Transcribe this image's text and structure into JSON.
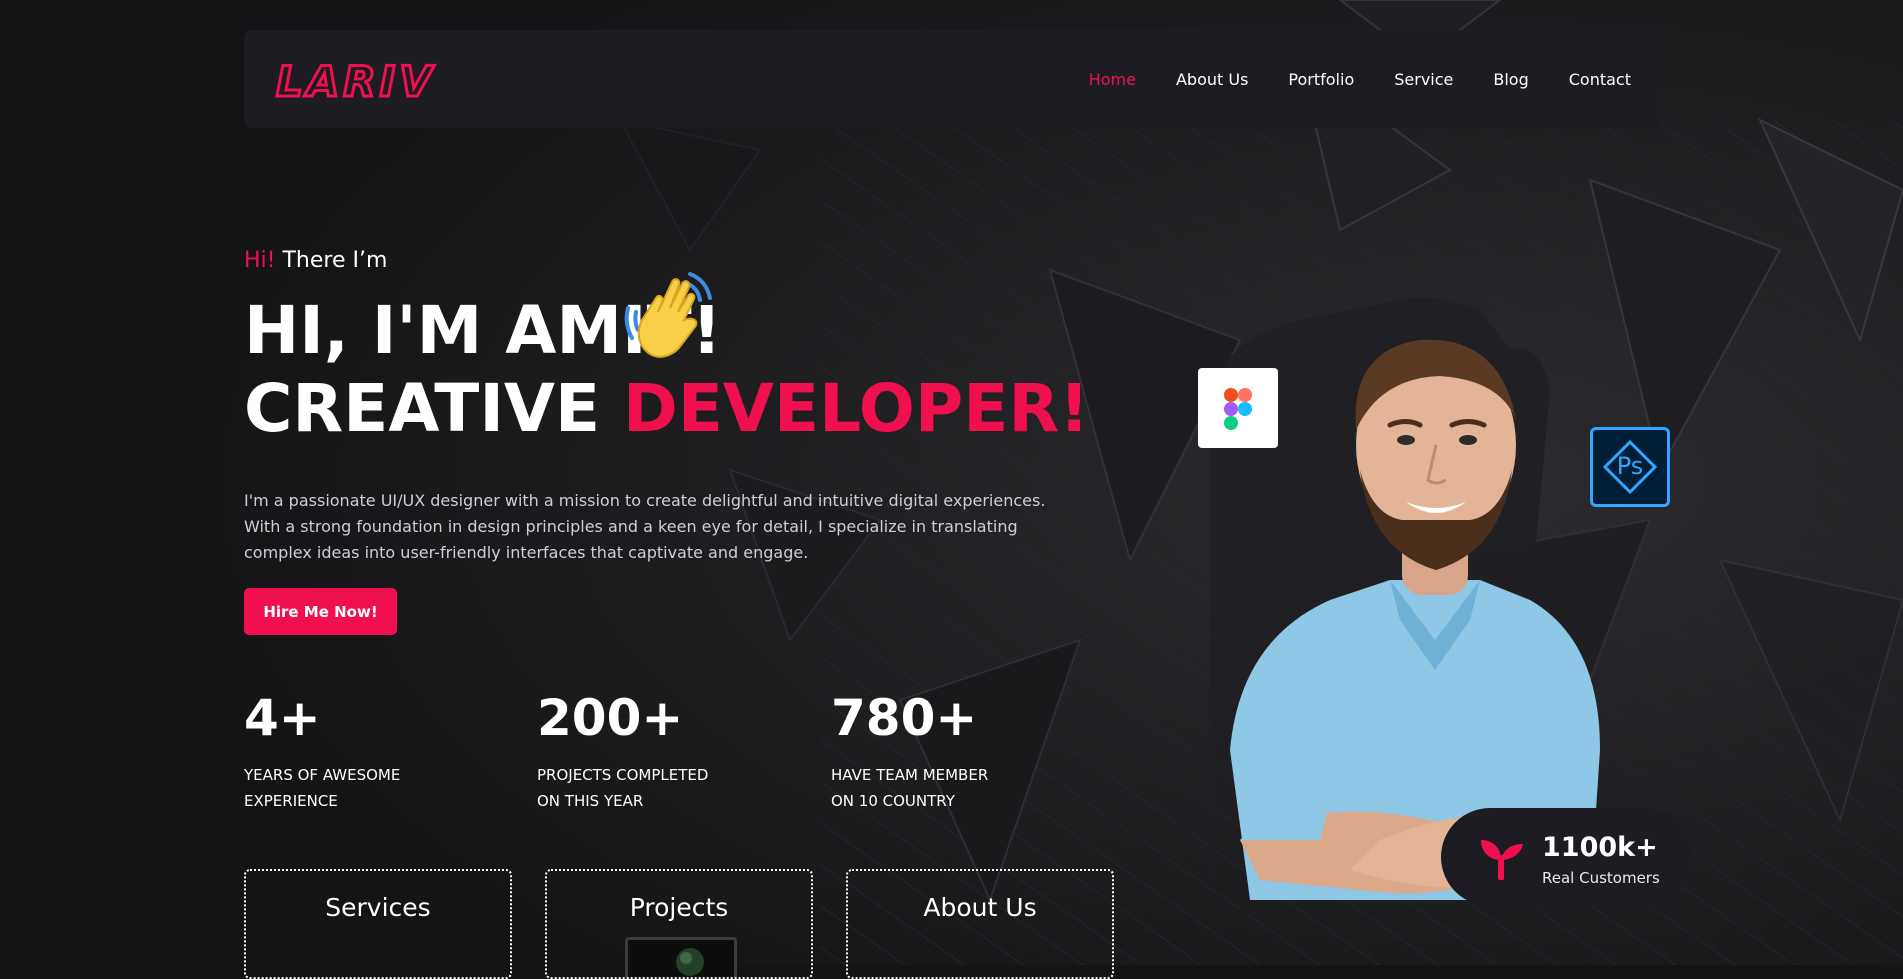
{
  "brand": {
    "logo_text": "LARIV",
    "accent_color": "#f0104f"
  },
  "nav": {
    "items": [
      {
        "label": "Home",
        "active": true
      },
      {
        "label": "About Us",
        "active": false
      },
      {
        "label": "Portfolio",
        "active": false
      },
      {
        "label": "Service",
        "active": false
      },
      {
        "label": "Blog",
        "active": false
      },
      {
        "label": "Contact",
        "active": false
      }
    ]
  },
  "hero": {
    "greeting_hi": "Hi!",
    "greeting_rest": "There I’m",
    "headline_line1": "HI, I'M AMIT!",
    "wave_icon": "waving-hand-icon",
    "headline_line2_white": "CREATIVE",
    "headline_line2_accent": "DEVELOPER!",
    "intro": "I'm a passionate UI/UX designer with a mission to create delightful and intuitive digital experiences. With a strong foundation in design principles and a keen eye for detail, I specialize in translating complex ideas into user-friendly interfaces that captivate and engage.",
    "cta_label": "Hire Me Now!"
  },
  "stats": [
    {
      "value": "4+",
      "label_line1": "YEARS OF AWESOME",
      "label_line2": "EXPERIENCE"
    },
    {
      "value": "200+",
      "label_line1": "PROJECTS COMPLETED",
      "label_line2": "ON THIS YEAR"
    },
    {
      "value": "780+",
      "label_line1": "HAVE TEAM MEMBER",
      "label_line2": "ON 10 COUNTRY"
    }
  ],
  "cards": [
    {
      "title": "Services"
    },
    {
      "title": "Projects"
    },
    {
      "title": "About Us"
    }
  ],
  "badges": {
    "figma_icon": "figma-icon",
    "photoshop_icon": "photoshop-icon",
    "photoshop_text": "Ps"
  },
  "customers": {
    "count": "1100k+",
    "label": "Real Customers",
    "icon": "sprout-icon"
  }
}
